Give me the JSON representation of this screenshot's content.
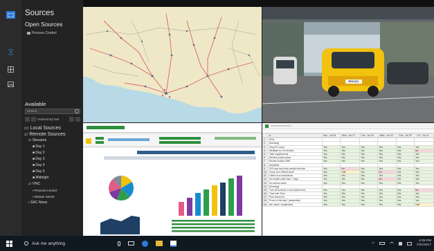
{
  "sidebar": {
    "title": "Sources",
    "open_sources_heading": "Open Sources",
    "open_items": [
      {
        "label": "Process Control"
      }
    ],
    "available_heading": "Available",
    "search_placeholder": "Search...",
    "sort_label": "Ordered By Nar",
    "tree": [
      {
        "label": "Local Sources",
        "level": 0
      },
      {
        "label": "Remote Sources",
        "level": 0
      },
      {
        "label": "Streams",
        "level": 1
      },
      {
        "label": "Day 1",
        "level": 2
      },
      {
        "label": "Day 2",
        "level": 2
      },
      {
        "label": "Day 3",
        "level": 2
      },
      {
        "label": "Day 4",
        "level": 2
      },
      {
        "label": "Day 5",
        "level": 2
      },
      {
        "label": "Midnight",
        "level": 2
      },
      {
        "label": "VNC",
        "level": 1
      },
      {
        "label": "Process Control",
        "level": 2
      },
      {
        "label": "Stream Server",
        "level": 2
      },
      {
        "label": "SAC News",
        "level": 1
      }
    ]
  },
  "sheet": {
    "columns": [
      "",
      "A",
      "Sun - Jul 16",
      "Mon - Jul 17",
      "Tue - Jul 18",
      "Wed - Jul 19",
      "Thu - Jul 20",
      "Fri - Jul 21"
    ],
    "rows": [
      {
        "n": "1",
        "label": "KPIs",
        "v": [
          "",
          "",
          "",
          "",
          "",
          ""
        ]
      },
      {
        "n": "2",
        "label": "[Morning]",
        "v": [
          "",
          "",
          "",
          "",
          "",
          ""
        ]
      },
      {
        "n": "3",
        "label": "Slept 8+ hours",
        "v": [
          "Yes",
          "Yes",
          "Yes",
          "Yes",
          "Yes",
          "Yes"
        ]
      },
      {
        "n": "4",
        "label": "Meditate for 20 minutes",
        "v": [
          "Yes",
          "Yes",
          "Yes",
          "Yes",
          "Yes",
          "No"
        ]
      },
      {
        "n": "5",
        "label": "Take supplements",
        "v": [
          "Yes",
          "Yes",
          "Yes",
          "Yes",
          "Yes",
          "Yes"
        ]
      },
      {
        "n": "6",
        "label": "Review project plans",
        "v": [
          "Yes",
          "Yes",
          "Yes",
          "Yes",
          "Yes",
          "Yes"
        ]
      },
      {
        "n": "7",
        "label": "Review today's MIM",
        "v": [
          "Yes",
          "Yes",
          "Yes",
          "Yes",
          "Yes",
          "Yes"
        ]
      },
      {
        "n": "8",
        "label": "[Anytime]",
        "v": [
          "",
          "",
          "",
          "",
          "",
          ""
        ]
      },
      {
        "n": "9",
        "label": "100 reps any body weight exercise",
        "v": [
          "Yes",
          "No",
          "Yes",
          "Yes",
          "Yes",
          "Yes"
        ]
      },
      {
        "n": "10",
        "label": "Close one GitHub issue",
        "v": [
          "Yes",
          "Half",
          "Yes",
          "No",
          "Yes",
          "Yes"
        ]
      },
      {
        "n": "11",
        "label": "Listen to an audiobook",
        "v": [
          "Yes",
          "Yes",
          "Yes",
          "Yes",
          "Yes",
          "Yes"
        ]
      },
      {
        "n": "12",
        "label": "No emails older than 7 days",
        "v": [
          "Yes",
          "Yes",
          "Yes",
          "No",
          "Yes",
          "Yes"
        ]
      },
      {
        "n": "13",
        "label": "No refined carbs",
        "v": [
          "Yes",
          "Yes",
          "Yes",
          "Yes",
          "Yes",
          "Yes"
        ]
      },
      {
        "n": "14",
        "label": "[Evening]",
        "v": [
          "",
          "",
          "",
          "",
          "",
          ""
        ]
      },
      {
        "n": "15",
        "label": "Turn off screens 1 hour before bed",
        "v": [
          "Yes",
          "Yes",
          "Yes",
          "Yes",
          "Yes",
          "No"
        ]
      },
      {
        "n": "16",
        "label": "Time with Terry",
        "v": [
          "Yes",
          "Yes",
          "Yes",
          "Yes",
          "Yes",
          "Yes"
        ]
      },
      {
        "n": "17",
        "label": "Plan tomorrow",
        "v": [
          "Yes",
          "Yes",
          "Yes",
          "Yes",
          "Yes",
          "Yes"
        ]
      },
      {
        "n": "18",
        "label": "Proud of the day? (subjective)",
        "v": [
          "Yes",
          "Yes",
          "Yes",
          "Yes",
          "Yes",
          "Yes"
        ]
      },
      {
        "n": "19",
        "label": "Ate clean? (subjective)",
        "v": [
          "Yes",
          "Yes",
          "Yes",
          "Yes",
          "Yes",
          "Half"
        ]
      }
    ]
  },
  "taskbar": {
    "search_text": "Ask me anything",
    "time": "4:35 PM",
    "date": "7/31/2017"
  },
  "taxi_plate": "FE10 DCL",
  "colors": {
    "accent": "#2d7bd6",
    "panel": "#232323",
    "rail": "#2b2b2b"
  }
}
